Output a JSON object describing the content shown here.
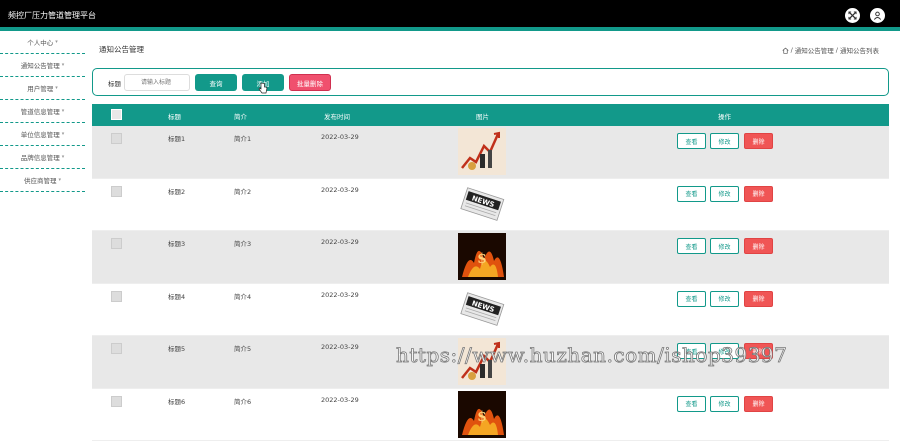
{
  "app": {
    "title": "频控厂压力管道管理平台"
  },
  "header_icons": [
    "fullscreen-icon",
    "user-icon"
  ],
  "sidebar": {
    "items": [
      {
        "label": "个人中心"
      },
      {
        "label": "通知公告管理"
      },
      {
        "label": "用户管理"
      },
      {
        "label": "管道信息管理"
      },
      {
        "label": "单位信息管理"
      },
      {
        "label": "品牌信息管理"
      },
      {
        "label": "供应商管理"
      }
    ]
  },
  "page": {
    "title": "通知公告管理",
    "breadcrumb": [
      "通知公告管理",
      "通知公告列表"
    ]
  },
  "search": {
    "label": "标题",
    "placeholder": "请输入标题",
    "search_label": "查询",
    "add_label": "添加",
    "bulk_delete_label": "批量删除"
  },
  "table": {
    "columns": {
      "title": "标题",
      "intro": "简介",
      "date": "发布时间",
      "image": "图片",
      "actions": "操作"
    },
    "rows": [
      {
        "title": "标题1",
        "intro": "简介1",
        "date": "2022-03-29",
        "image": "chart-image"
      },
      {
        "title": "标题2",
        "intro": "简介2",
        "date": "2022-03-29",
        "image": "newspaper-image"
      },
      {
        "title": "标题3",
        "intro": "简介3",
        "date": "2022-03-29",
        "image": "burning-money-image"
      },
      {
        "title": "标题4",
        "intro": "简介4",
        "date": "2022-03-29",
        "image": "newspaper-image"
      },
      {
        "title": "标题5",
        "intro": "简介5",
        "date": "2022-03-29",
        "image": "chart-image"
      },
      {
        "title": "标题6",
        "intro": "简介6",
        "date": "2022-03-29",
        "image": "burning-money-image"
      }
    ],
    "actions": {
      "view": "查看",
      "edit": "修改",
      "delete": "删除"
    }
  },
  "watermark": "https://www.huzhan.com/ishop39397",
  "colors": {
    "accent": "#12998a",
    "danger": "#f05555",
    "topbar": "#000000"
  }
}
